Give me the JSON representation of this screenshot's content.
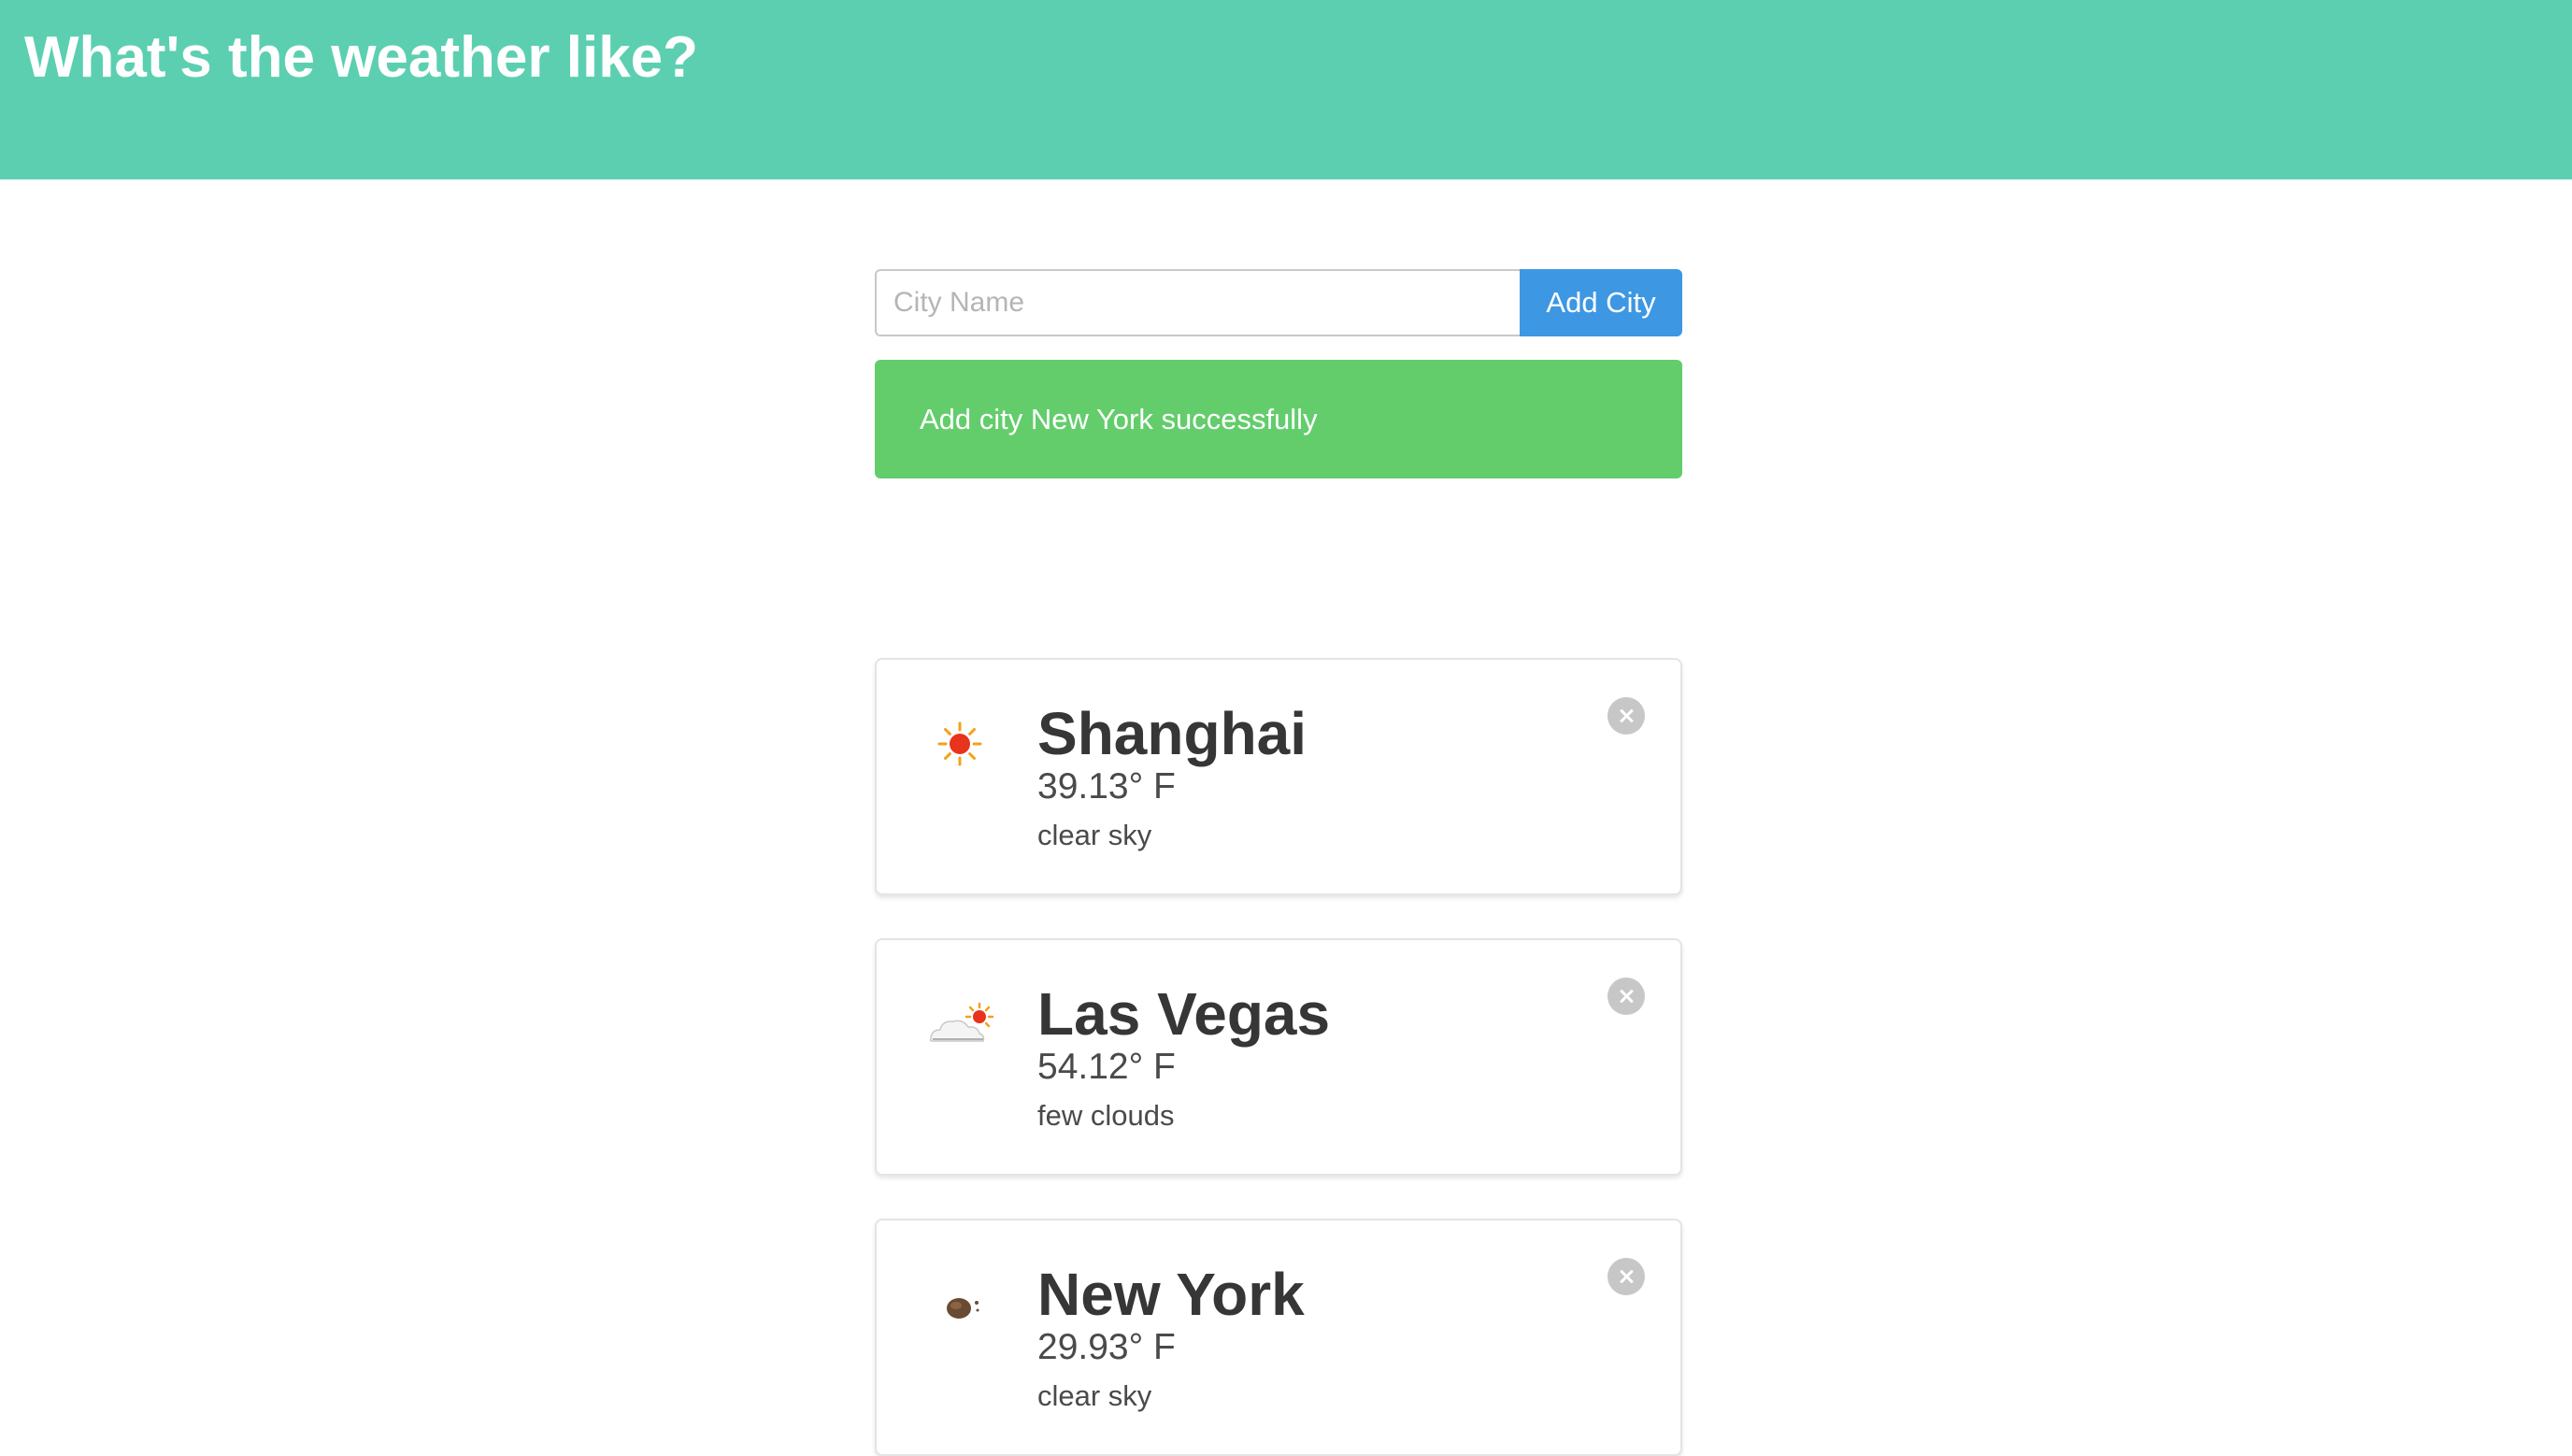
{
  "header": {
    "title": "What's the weather like?",
    "background_color": "#5ccfb1"
  },
  "form": {
    "city_input_placeholder": "City Name",
    "city_input_value": "",
    "add_button_label": "Add City",
    "button_color": "#3d97e3"
  },
  "notification": {
    "message": "Add city New York successfully",
    "color": "#63cd6c"
  },
  "cities": [
    {
      "name": "Shanghai",
      "temperature": "39.13° F",
      "description": "clear sky",
      "icon": "sun-icon"
    },
    {
      "name": "Las Vegas",
      "temperature": "54.12° F",
      "description": "few clouds",
      "icon": "cloud-sun-icon"
    },
    {
      "name": "New York",
      "temperature": "29.93° F",
      "description": "clear sky",
      "icon": "moon-icon"
    }
  ]
}
